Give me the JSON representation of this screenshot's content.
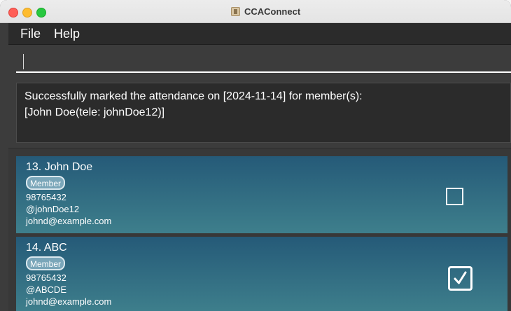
{
  "window": {
    "title": "CCAConnect",
    "icon": "app-icon"
  },
  "menubar": {
    "file_label": "File",
    "help_label": "Help"
  },
  "command_box": {
    "value": "",
    "placeholder": ""
  },
  "result": {
    "text": "Successfully marked the attendance on [2024-11-14] for member(s):\n[John Doe(tele: johnDoe12)]"
  },
  "members": [
    {
      "index_name": "13. John Doe",
      "tag": "Member",
      "phone": "98765432",
      "tele": "@johnDoe12",
      "email": "johnd@example.com",
      "attended": false
    },
    {
      "index_name": "14. ABC",
      "tag": "Member",
      "phone": "98765432",
      "tele": "@ABCDE",
      "email": "johnd@example.com",
      "attended": true
    }
  ],
  "colors": {
    "card_gradient_top": "#255a78",
    "card_gradient_bottom": "#3e7f8c",
    "background": "#3c3c3c"
  }
}
